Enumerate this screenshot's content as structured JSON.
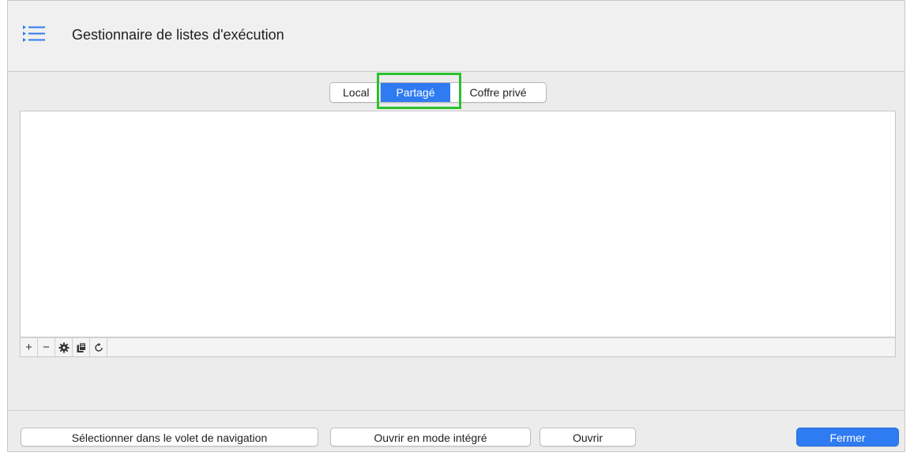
{
  "window": {
    "title": "Gestionnaire de listes d'exécution",
    "icon": "list-icon"
  },
  "tabs": [
    {
      "label": "Local",
      "selected": false
    },
    {
      "label": "Partagé",
      "selected": true
    },
    {
      "label": "Coffre privé",
      "selected": false
    }
  ],
  "toolbar": {
    "add": "+",
    "remove": "−",
    "settings": "gear-icon",
    "copy": "duplicate-icon",
    "refresh": "refresh-icon"
  },
  "footer": {
    "select_label": "Sélectionner dans le volet de navigation",
    "integrated_label": "Ouvrir en mode intégré",
    "open_label": "Ouvrir",
    "close_label": "Fermer"
  },
  "colors": {
    "accent": "#2f7bf1",
    "highlight": "#2bc12e",
    "background": "#ececec"
  }
}
